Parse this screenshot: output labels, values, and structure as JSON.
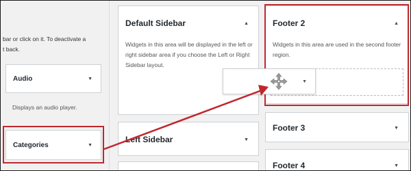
{
  "available_widgets": {
    "intro_text": "bar or click on it. To deactivate a\nt back.",
    "audio": {
      "title": "Audio",
      "description": "Displays an audio player."
    },
    "categories": {
      "title": "Categories"
    }
  },
  "sidebars": {
    "default": {
      "title": "Default Sidebar",
      "description": "Widgets in this area will be displayed in the left or right sidebar area if you choose the Left or Right Sidebar layout."
    },
    "footer2": {
      "title": "Footer 2",
      "description": "Widgets in this area are used in the second footer region."
    },
    "left": {
      "title": "Left Sidebar"
    },
    "footer3": {
      "title": "Footer 3"
    },
    "footer4": {
      "title": "Footer 4"
    }
  },
  "colors": {
    "highlight": "#c0272d"
  },
  "icons": {
    "toggle": "triangle-down",
    "panel_toggle": "triangle-up",
    "drag": "move-cross"
  }
}
